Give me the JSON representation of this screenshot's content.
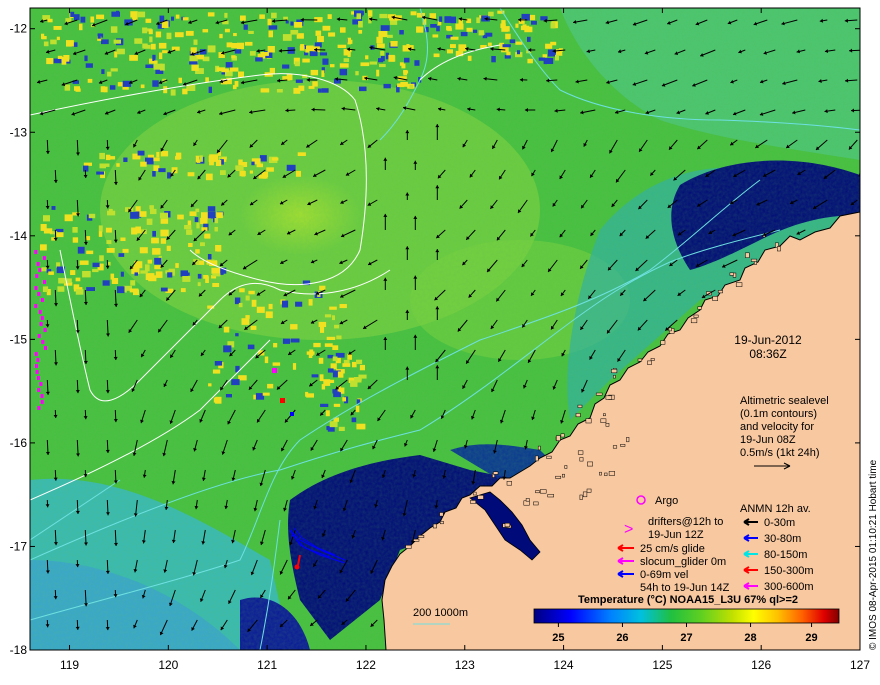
{
  "map": {
    "y_ticks": [
      "-12",
      "-13",
      "-14",
      "-15",
      "-16",
      "-17",
      "-18"
    ],
    "x_ticks": [
      "119",
      "120",
      "121",
      "122",
      "123",
      "124",
      "125",
      "126",
      "127"
    ],
    "lon_range": [
      118.6,
      127
    ],
    "lat_range": [
      -18,
      -11.8
    ]
  },
  "info": {
    "date": "19-Jun-2012",
    "time": "08:36Z",
    "altimetry_lines": [
      "Altimetric sealevel",
      "(0.1m contours)",
      "and velocity for",
      "19-Jun 08Z",
      "0.5m/s (1kt 24h)"
    ]
  },
  "legend": {
    "argo": "Argo",
    "drifters": [
      "drifters@12h to",
      "19-Jun 12Z"
    ],
    "glide": "25 cm/s glide",
    "slocum": "slocum_glider 0m",
    "vel": [
      "0-69m vel",
      "54h to 19-Jun 14Z"
    ],
    "anmn_title": "ANMN 12h av.",
    "anmn_items": [
      {
        "label": "0-30m",
        "color": "#000000"
      },
      {
        "label": "30-80m",
        "color": "#0000ff"
      },
      {
        "label": "80-150m",
        "color": "#00e5e5"
      },
      {
        "label": "150-300m",
        "color": "#ff0000"
      },
      {
        "label": "300-600m",
        "color": "#ff00ff"
      }
    ],
    "isobath": "200  1000m"
  },
  "colorbar": {
    "title": "Temperature (°C) NOAA15_L3U 67% ql>=2",
    "ticks": [
      "25",
      "26",
      "27",
      "28",
      "29"
    ]
  },
  "credit": "© IMOS 08-Apr-2015 01:10:21 Hobart time",
  "colors": {
    "land": "#f8c8a0",
    "deep_blue": "#000a78",
    "mid_green": "#40c040",
    "light_green": "#80d840",
    "cyan_blue": "#30a8d8",
    "yellow": "#f0e020"
  }
}
